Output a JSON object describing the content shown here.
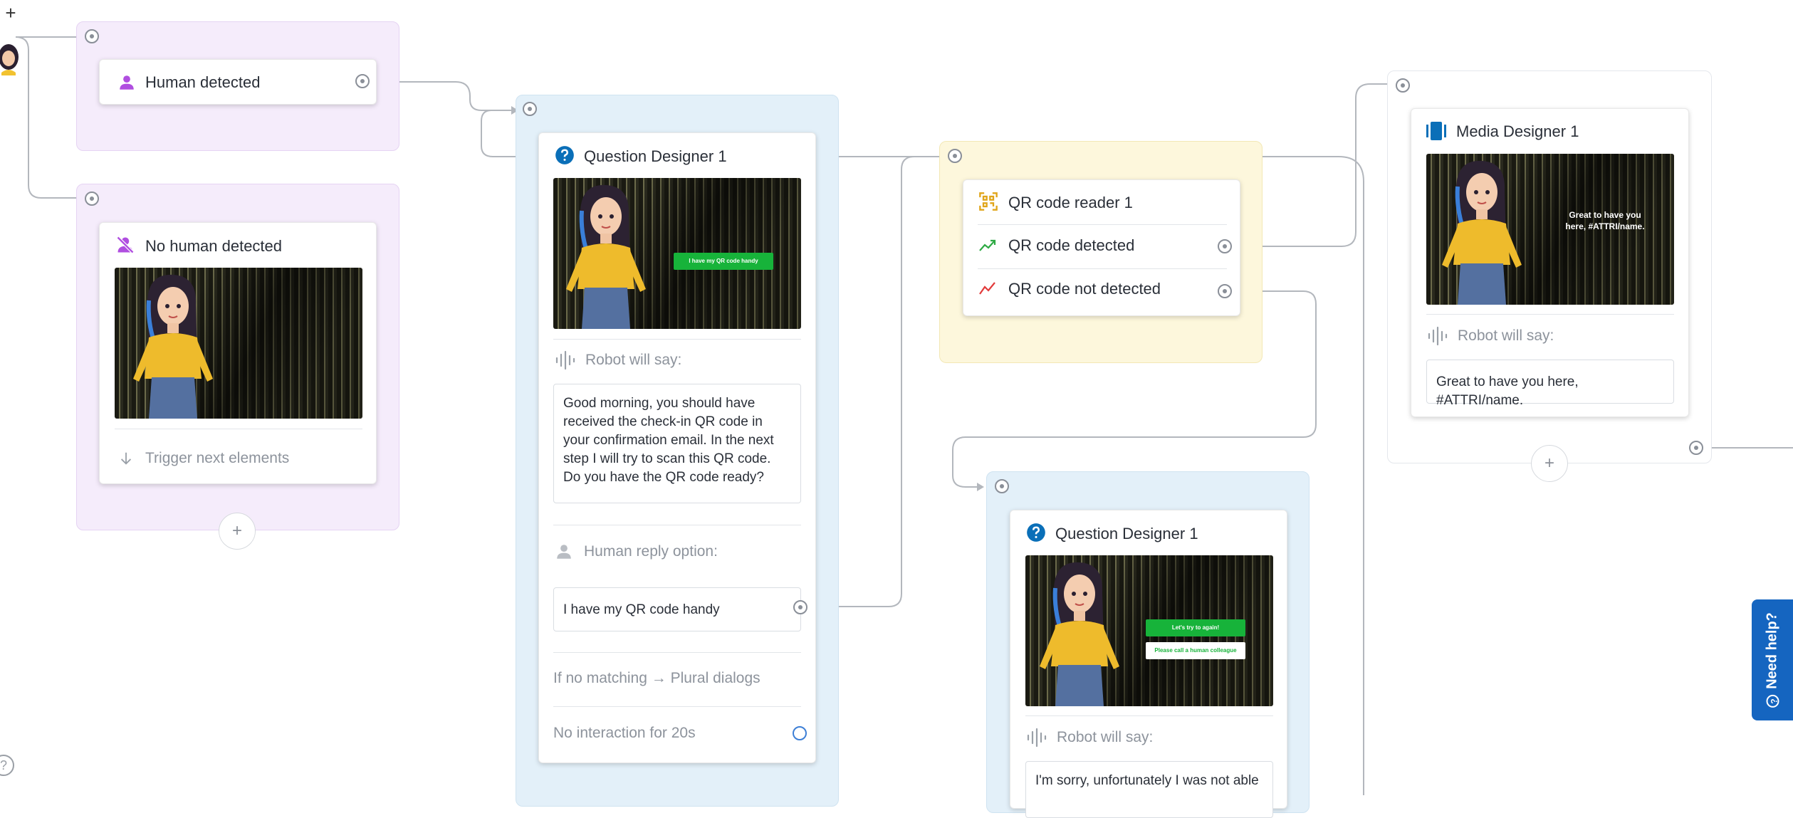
{
  "nodes": {
    "human_detected": {
      "title": "Human detected"
    },
    "no_human_detected": {
      "title": "No human detected",
      "trigger": "Trigger next elements"
    },
    "question_designer_a": {
      "title": "Question Designer 1",
      "scene_button": "I have my QR code handy",
      "robot_label": "Robot will say:",
      "robot_text": "Good morning, you should have received the check-in QR code in your confirmation email. In the next step I will try to scan this QR code. Do you have the QR code ready?",
      "reply_label": "Human reply option:",
      "reply_text": "I have my QR code handy",
      "no_match": "If no matching → Plural dialogs",
      "no_interaction": "No interaction for 20s"
    },
    "qr_reader": {
      "title": "QR code reader 1",
      "detected": "QR code detected",
      "not_detected": "QR code not detected"
    },
    "media_designer": {
      "title": "Media Designer 1",
      "scene_text": "Great to have you here, #ATTRI/name.",
      "robot_label": "Robot will say:",
      "robot_text": "Great to have you here, #ATTRI/name."
    },
    "question_designer_b": {
      "title": "Question Designer 1",
      "scene_button_1": "Let's try to again!",
      "scene_button_2": "Please call a human colleague",
      "robot_label": "Robot will say:",
      "robot_text": "I'm sorry, unfortunately I was not able"
    }
  },
  "toolbar": {
    "add_symbol": "+",
    "help_symbol": "?"
  },
  "help_tab": {
    "label": "Need help?"
  },
  "add_button_symbol": "+",
  "colors": {
    "purple_group": "#f5ecfb",
    "blue_group": "#e3f0f9",
    "yellow_group": "#fdf7dc",
    "wire": "#b3b7bd",
    "help_tab": "#1565c0",
    "question_icon": "#0a6fb8",
    "person_icon": "#b04ee0",
    "qr_icon": "#e0a51a",
    "detected_green": "#2eaa44",
    "not_detected_red": "#e23b3b"
  }
}
